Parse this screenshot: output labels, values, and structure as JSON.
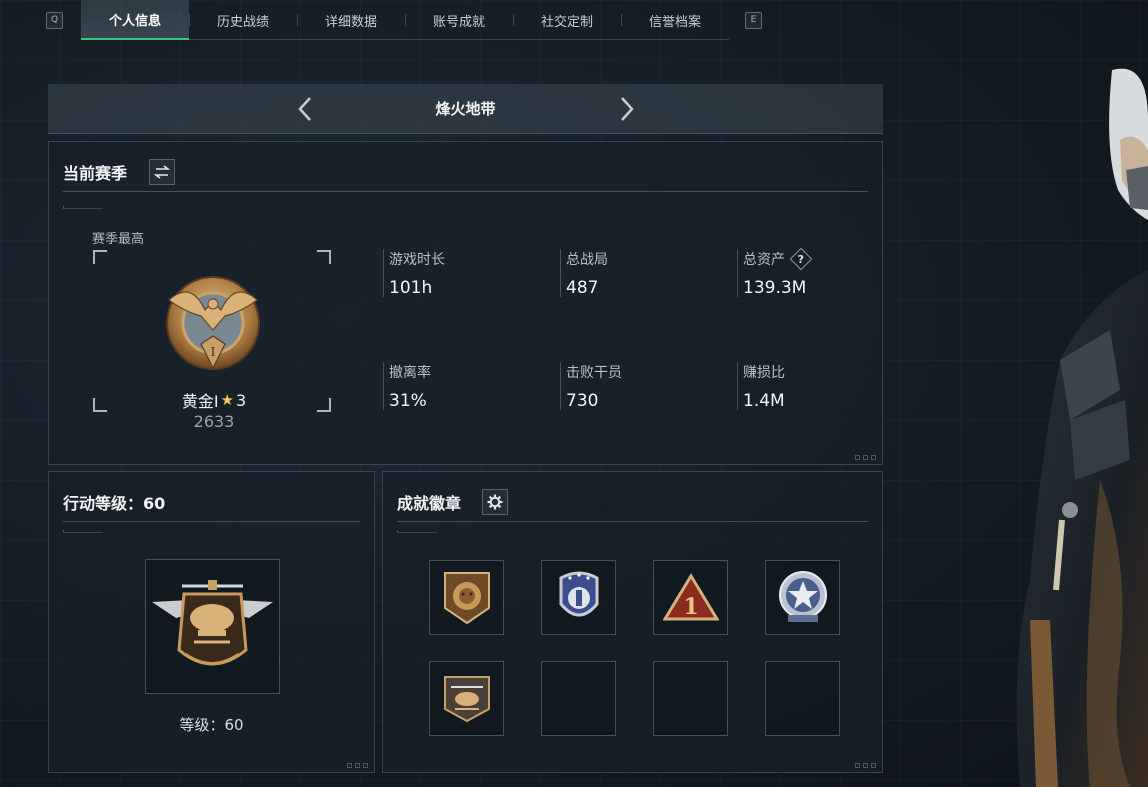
{
  "nav": {
    "left_key": "Q",
    "right_key": "E",
    "tabs": [
      "个人信息",
      "历史战绩",
      "详细数据",
      "账号成就",
      "社交定制",
      "信誉档案"
    ],
    "active_tab": "个人信息",
    "active_color": "#37c97a"
  },
  "mode": {
    "title": "烽火地带"
  },
  "season": {
    "title": "当前赛季",
    "best_label": "赛季最高",
    "rank_name": "黄金I",
    "rank_stars": "3",
    "rank_score": "2633",
    "stats": [
      {
        "label": "游戏时长",
        "value": "101h"
      },
      {
        "label": "总战局",
        "value": "487"
      },
      {
        "label": "总资产",
        "value": "139.3M",
        "help": "?"
      },
      {
        "label": "撤离率",
        "value": "31%"
      },
      {
        "label": "击败干员",
        "value": "730"
      },
      {
        "label": "赚损比",
        "value": "1.4M"
      }
    ]
  },
  "level": {
    "title": "行动等级：60",
    "level_text": "等级：60"
  },
  "achievements": {
    "title": "成就徽章",
    "slots": [
      "lion-badge-icon",
      "shield-badge-icon",
      "triangle-one-badge-icon",
      "star-badge-icon",
      "helicopter-badge-icon",
      "empty",
      "empty",
      "empty"
    ]
  }
}
